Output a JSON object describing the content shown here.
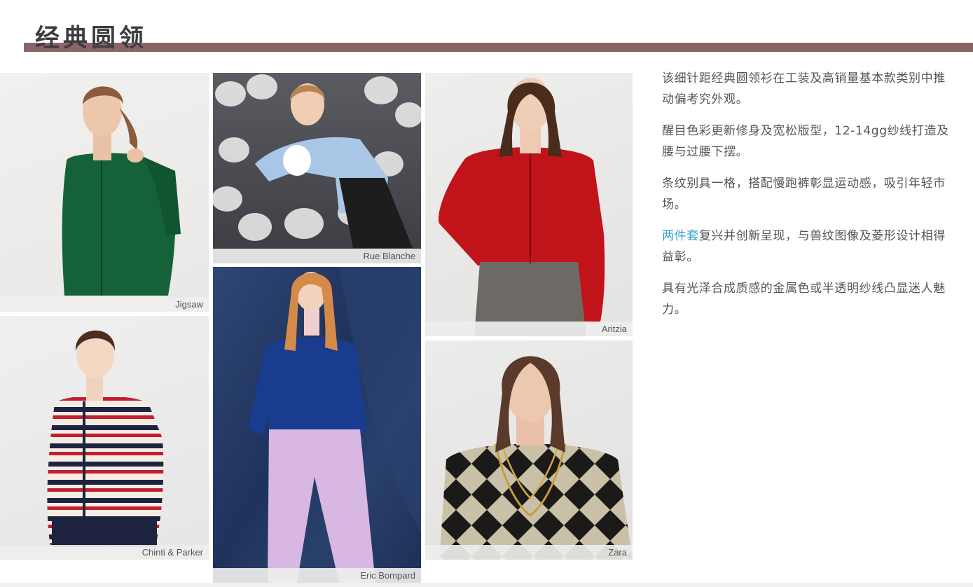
{
  "page": {
    "title": "经典圆领",
    "accent_color": "#8a6567",
    "link_color": "#2fa2cc"
  },
  "photos": [
    {
      "brand": "Jigsaw",
      "subject": "green cardigan"
    },
    {
      "brand": "Chinti & Parker",
      "subject": "striped cardigan"
    },
    {
      "brand": "Rue Blanche",
      "subject": "light blue cardigan"
    },
    {
      "brand": "Eric Bompard",
      "subject": "navy cardigan with lilac trousers"
    },
    {
      "brand": "Aritzia",
      "subject": "red cropped cardigan"
    },
    {
      "brand": "Zara",
      "subject": "argyle jacquard cardigan"
    }
  ],
  "text": {
    "p1": "该细针距经典圆领衫在工装及高销量基本款类别中推动偏考究外观。",
    "p2": "醒目色彩更新修身及宽松版型，12-14gg纱线打造及腰与过腰下摆。",
    "p3": "条纹别具一格，搭配慢跑裤彰显运动感，吸引年轻市场。",
    "p4_highlight": "两件套",
    "p4_rest": "复兴并创新呈现，与兽纹图像及菱形设计相得益彰。",
    "p5": "具有光泽合成质感的金属色或半透明纱线凸显迷人魅力。"
  }
}
